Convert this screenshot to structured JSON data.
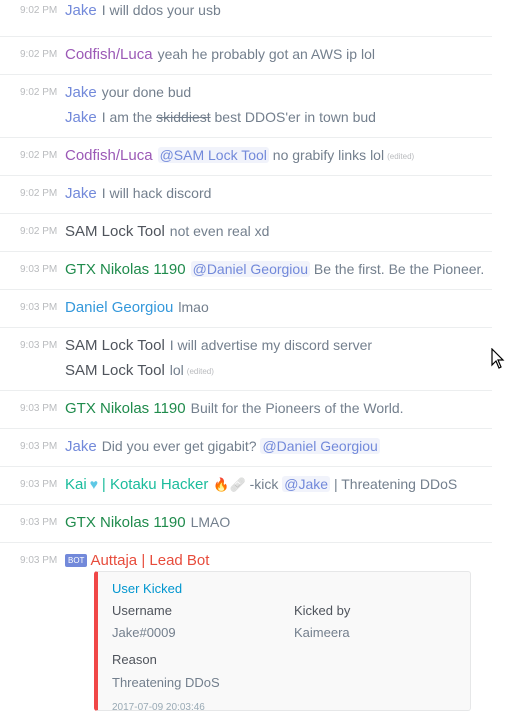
{
  "colors": {
    "jake": "#7289da",
    "codfish": "#9b59b6",
    "sam": "#4f545c",
    "gtx": "#1f8b4c",
    "daniel": "#3498db",
    "kai": "#1abc9c",
    "auttaja": "#e74c3c",
    "embed_accent": "#f04747"
  },
  "messages": [
    {
      "time": "9:02 PM",
      "author": "Jake",
      "text": "I will ddos your usb"
    },
    {
      "time": "9:02 PM",
      "author": "Codfish/Luca",
      "text": "yeah he probably got an AWS ip lol"
    },
    {
      "time": "9:02 PM",
      "author": "Jake",
      "text": "your done bud",
      "text2_pre": "I am the ",
      "text2_strike": "skiddiest",
      "text2_post": " best DDOS'er in town bud"
    },
    {
      "time": "9:02 PM",
      "author": "Codfish/Luca",
      "mention": "@SAM Lock Tool",
      "text": " no grabify links lol",
      "edited": "(edited)"
    },
    {
      "time": "9:02 PM",
      "author": "Jake",
      "text": "I will hack discord"
    },
    {
      "time": "9:02 PM",
      "author": "SAM Lock Tool",
      "text": "not even real xd"
    },
    {
      "time": "9:03 PM",
      "author": "GTX Nikolas 1190",
      "mention": "@Daniel Georgiou",
      "text": " Be the first. Be the Pioneer."
    },
    {
      "time": "9:03 PM",
      "author": "Daniel Georgiou",
      "text": "lmao"
    },
    {
      "time": "9:03 PM",
      "author": "SAM Lock Tool",
      "text": "I will advertise my discord server",
      "author2": "SAM Lock Tool",
      "text2": "lol",
      "edited": "(edited)"
    },
    {
      "time": "9:03 PM",
      "author": "GTX Nikolas 1190",
      "text": "Built for the Pioneers of the World."
    },
    {
      "time": "9:03 PM",
      "author": "Jake",
      "text": "Did you ever get gigabit? ",
      "mention": "@Daniel Georgiou"
    },
    {
      "time": "9:03 PM",
      "author": "Kai",
      "author_mid": "| Kotaku Hacker",
      "emoji": "🔥🩹",
      "text_pre": "-kick ",
      "mention": "@Jake",
      "text": " | Threatening DDoS"
    },
    {
      "time": "9:03 PM",
      "author": "GTX Nikolas 1190",
      "text": "LMAO"
    },
    {
      "time": "9:03 PM",
      "bot_tag": "BOT",
      "author": "Auttaja | Lead Bot"
    }
  ],
  "embed": {
    "title": "User Kicked",
    "username_label": "Username",
    "username_value": "Jake#0009",
    "kickedby_label": "Kicked by",
    "kickedby_value": "Kaimeera",
    "reason_label": "Reason",
    "reason_value": "Threatening DDoS",
    "footer": "2017-07-09 20:03:46"
  },
  "icons": {
    "heart": "heart-emoji",
    "fire": "fire-emoji",
    "cursor": "cursor-arrow-icon"
  }
}
